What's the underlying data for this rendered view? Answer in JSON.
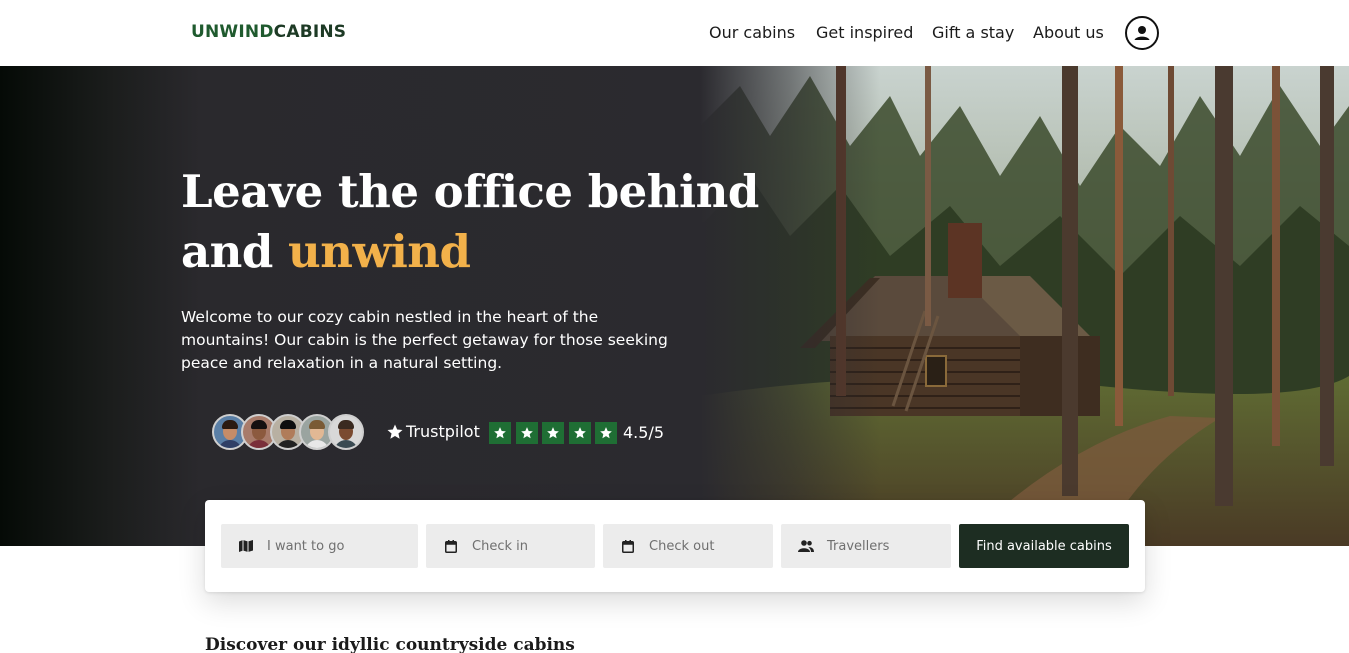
{
  "brand": {
    "logo_part1": "UNWIND",
    "logo_part2": "CABINS",
    "logo_color1": "#1f5a2e",
    "logo_color2": "#1d3a25"
  },
  "nav": {
    "items": [
      {
        "label": "Our cabins"
      },
      {
        "label": "Get inspired"
      },
      {
        "label": "Gift a stay"
      },
      {
        "label": "About us"
      }
    ],
    "account_icon": "user-circle-icon"
  },
  "hero": {
    "title_line1": "Leave the office behind",
    "title_line2_prefix": "and ",
    "title_line2_accent": "unwind",
    "accent_color": "#f2b14a",
    "description": "Welcome to our cozy cabin nestled in the heart of the mountains! Our cabin is the perfect getaway for those seeking peace and relaxation in a natural setting.",
    "review_avatars": 5,
    "trustpilot_label": "Trustpilot",
    "star_count": 5,
    "star_color": "#1f6e34",
    "rating": "4.5/5",
    "image_icon": "cabin-in-forest-photo"
  },
  "search": {
    "destination": {
      "placeholder": "I want to go",
      "icon": "map-icon"
    },
    "check_in": {
      "placeholder": "Check in",
      "icon": "calendar-icon"
    },
    "check_out": {
      "placeholder": "Check out",
      "icon": "calendar-icon"
    },
    "travellers": {
      "placeholder": "Travellers",
      "icon": "people-icon"
    },
    "submit_label": "Find available cabins",
    "submit_color": "#1d2d22"
  },
  "section": {
    "title": "Discover our idyllic countryside cabins"
  }
}
